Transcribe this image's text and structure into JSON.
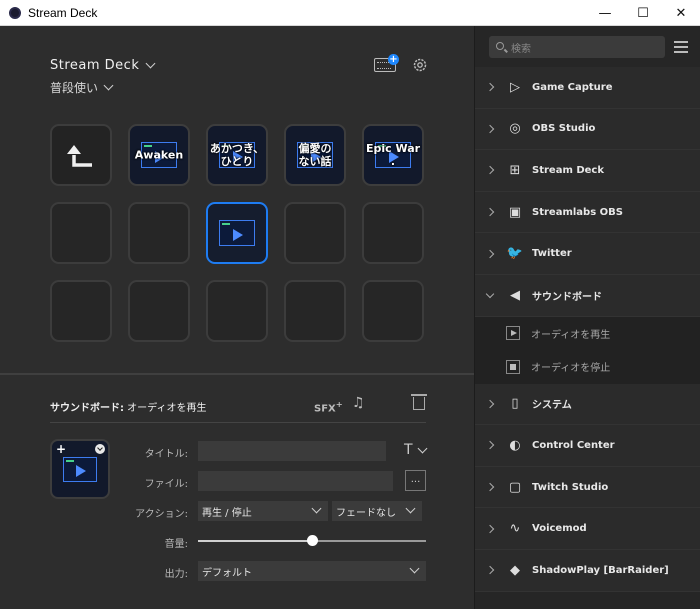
{
  "window": {
    "title": "Stream Deck",
    "controls": [
      "—",
      "☐",
      "✕"
    ]
  },
  "header": {
    "device_name": "Stream Deck",
    "profile_name": "普段使い"
  },
  "keys": [
    {
      "type": "back",
      "label": ""
    },
    {
      "type": "action",
      "label": "Awaken"
    },
    {
      "type": "action",
      "label": "あかつき、\nひとり"
    },
    {
      "type": "action",
      "label": "偏愛の\nない話"
    },
    {
      "type": "action",
      "label": "Epic War ."
    },
    {
      "type": "empty",
      "label": ""
    },
    {
      "type": "empty",
      "label": ""
    },
    {
      "type": "selected",
      "label": ""
    },
    {
      "type": "empty",
      "label": ""
    },
    {
      "type": "empty",
      "label": ""
    },
    {
      "type": "empty",
      "label": ""
    },
    {
      "type": "empty",
      "label": ""
    },
    {
      "type": "empty",
      "label": ""
    },
    {
      "type": "empty",
      "label": ""
    },
    {
      "type": "empty",
      "label": ""
    }
  ],
  "properties": {
    "plugin": "サウンドボード:",
    "action": " オーディオを再生",
    "sfx_label": "SFX",
    "title_label": "タイトル:",
    "title_value": "",
    "title_font_button": "T",
    "file_label": "ファイル:",
    "file_value": "",
    "browse_label": "...",
    "action_label": "アクション:",
    "action_value": "再生 / 停止",
    "fade_value": "フェードなし",
    "volume_label": "音量:",
    "volume_fraction": 0.5,
    "output_label": "出力:",
    "output_value": "デフォルト"
  },
  "sidebar": {
    "search_placeholder": "検索",
    "categories": [
      {
        "name": "Game Capture",
        "icon": "game-capture-icon",
        "glyph": "▷"
      },
      {
        "name": "OBS Studio",
        "icon": "obs-icon",
        "glyph": "◎"
      },
      {
        "name": "Stream Deck",
        "icon": "stream-deck-icon",
        "glyph": "⊞"
      },
      {
        "name": "Streamlabs OBS",
        "icon": "streamlabs-icon",
        "glyph": "▣"
      },
      {
        "name": "Twitter",
        "icon": "twitter-icon",
        "glyph": "🐦"
      },
      {
        "name": "サウンドボード",
        "icon": "soundboard-icon",
        "glyph": "◀",
        "open": true,
        "items": [
          {
            "name": "オーディオを再生",
            "icon": "play"
          },
          {
            "name": "オーディオを停止",
            "icon": "stop"
          }
        ]
      },
      {
        "name": "システム",
        "icon": "system-icon",
        "glyph": "▯"
      },
      {
        "name": "Control Center",
        "icon": "control-center-icon",
        "glyph": "◐"
      },
      {
        "name": "Twitch Studio",
        "icon": "twitch-icon",
        "glyph": "▢"
      },
      {
        "name": "Voicemod",
        "icon": "voicemod-icon",
        "glyph": "∿"
      },
      {
        "name": "ShadowPlay [BarRaider]",
        "icon": "shadowplay-icon",
        "glyph": "◆"
      }
    ]
  }
}
